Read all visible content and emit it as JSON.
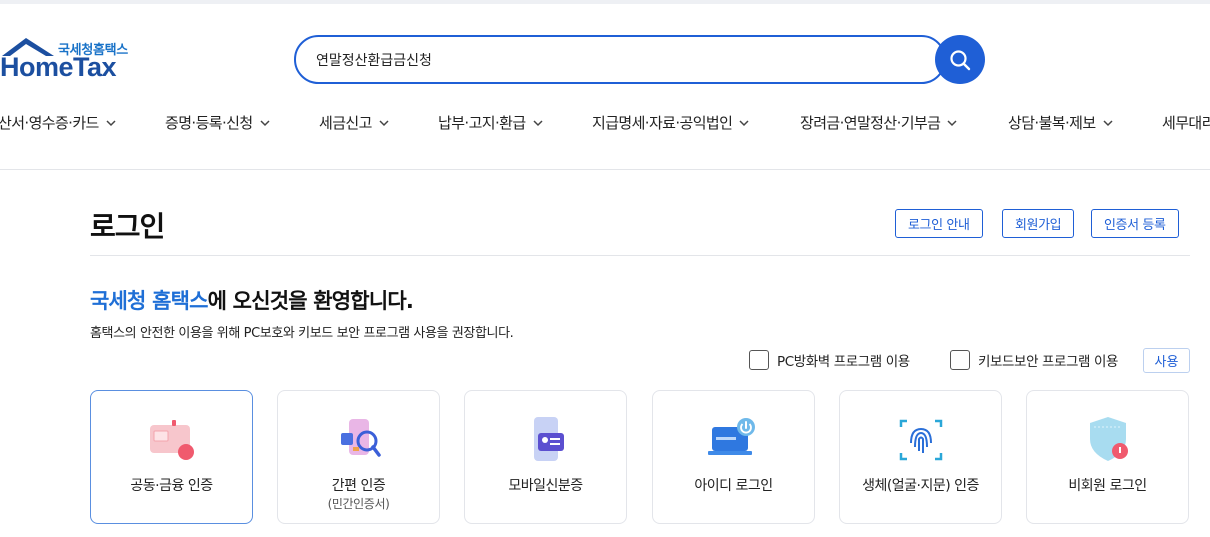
{
  "brand": {
    "sub_name": "국세청홈택스",
    "main_name": "HomeTax"
  },
  "search": {
    "value": "연말정산환급금신청"
  },
  "nav": {
    "items": [
      "산서·영수증·카드",
      "증명·등록·신청",
      "세금신고",
      "납부·고지·환급",
      "지급명세·자료·공익법인",
      "장려금·연말정산·기부금",
      "상담·불복·제보",
      "세무대리"
    ]
  },
  "login": {
    "title": "로그인",
    "buttons": [
      "로그인 안내",
      "회원가입",
      "인증서 등록"
    ],
    "welcome_highlight": "국세청 홈택스",
    "welcome_rest": "에 오신것을 환영합니다.",
    "description": "홈택스의 안전한 이용을 위해 PC보호와 키보드 보안 프로그램 사용을 권장합니다.",
    "checks": [
      "PC방화벽 프로그램 이용",
      "키보드보안 프로그램 이용"
    ],
    "use_label": "사용"
  },
  "methods": [
    {
      "label": "공동·금융 인증",
      "sub": "",
      "icon": "certificate-card-icon"
    },
    {
      "label": "간편 인증",
      "sub": "(민간인증서)",
      "icon": "simple-auth-icon"
    },
    {
      "label": "모바일신분증",
      "sub": "",
      "icon": "mobile-id-icon"
    },
    {
      "label": "아이디 로그인",
      "sub": "",
      "icon": "id-login-icon"
    },
    {
      "label": "생체(얼굴·지문) 인증",
      "sub": "",
      "icon": "fingerprint-icon"
    },
    {
      "label": "비회원 로그인",
      "sub": "",
      "icon": "non-member-icon"
    }
  ],
  "colors": {
    "accent": "#1f5fd6",
    "brand_dark": "#1c4fa0",
    "highlight": "#1f6fd6"
  }
}
